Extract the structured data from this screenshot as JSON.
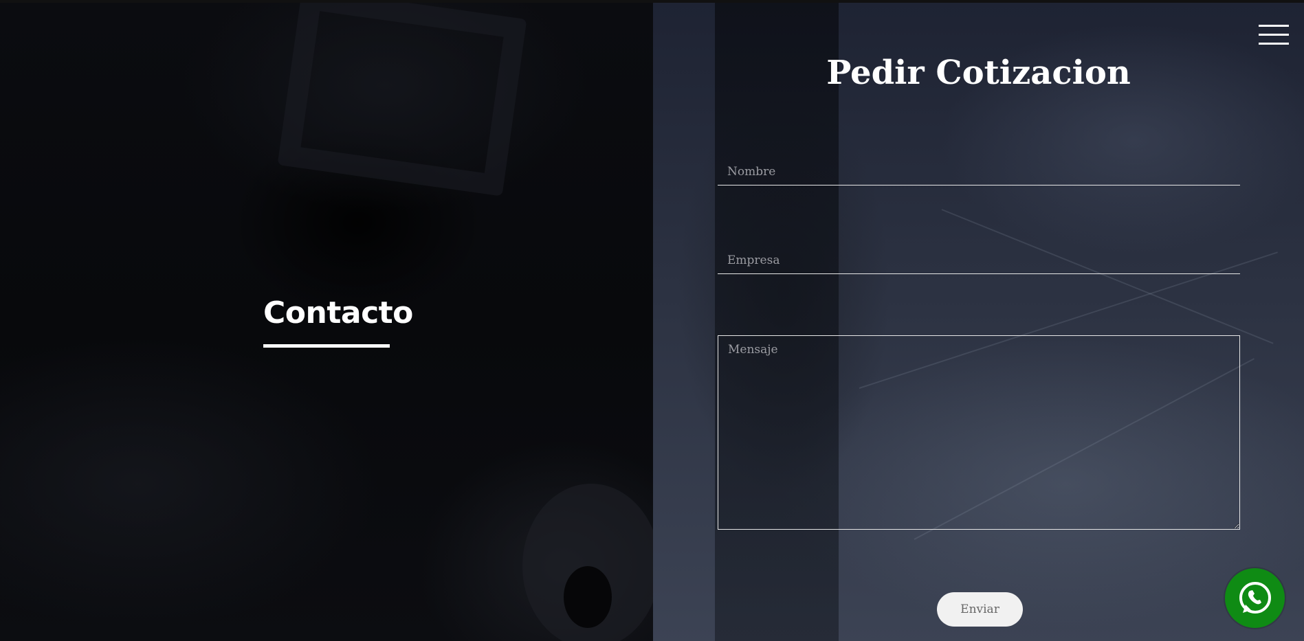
{
  "left": {
    "title": "Contacto"
  },
  "form": {
    "title": "Pedir Cotizacion",
    "name_placeholder": "Nombre",
    "name_value": "",
    "company_placeholder": "Empresa",
    "company_value": "",
    "message_placeholder": "Mensaje",
    "message_value": "",
    "submit_label": "Enviar"
  },
  "icons": {
    "menu": "hamburger-menu-icon",
    "whatsapp": "whatsapp-icon"
  },
  "colors": {
    "whatsapp": "#0f8b14",
    "button_bg": "#f1f1f1",
    "text": "#ffffff"
  }
}
